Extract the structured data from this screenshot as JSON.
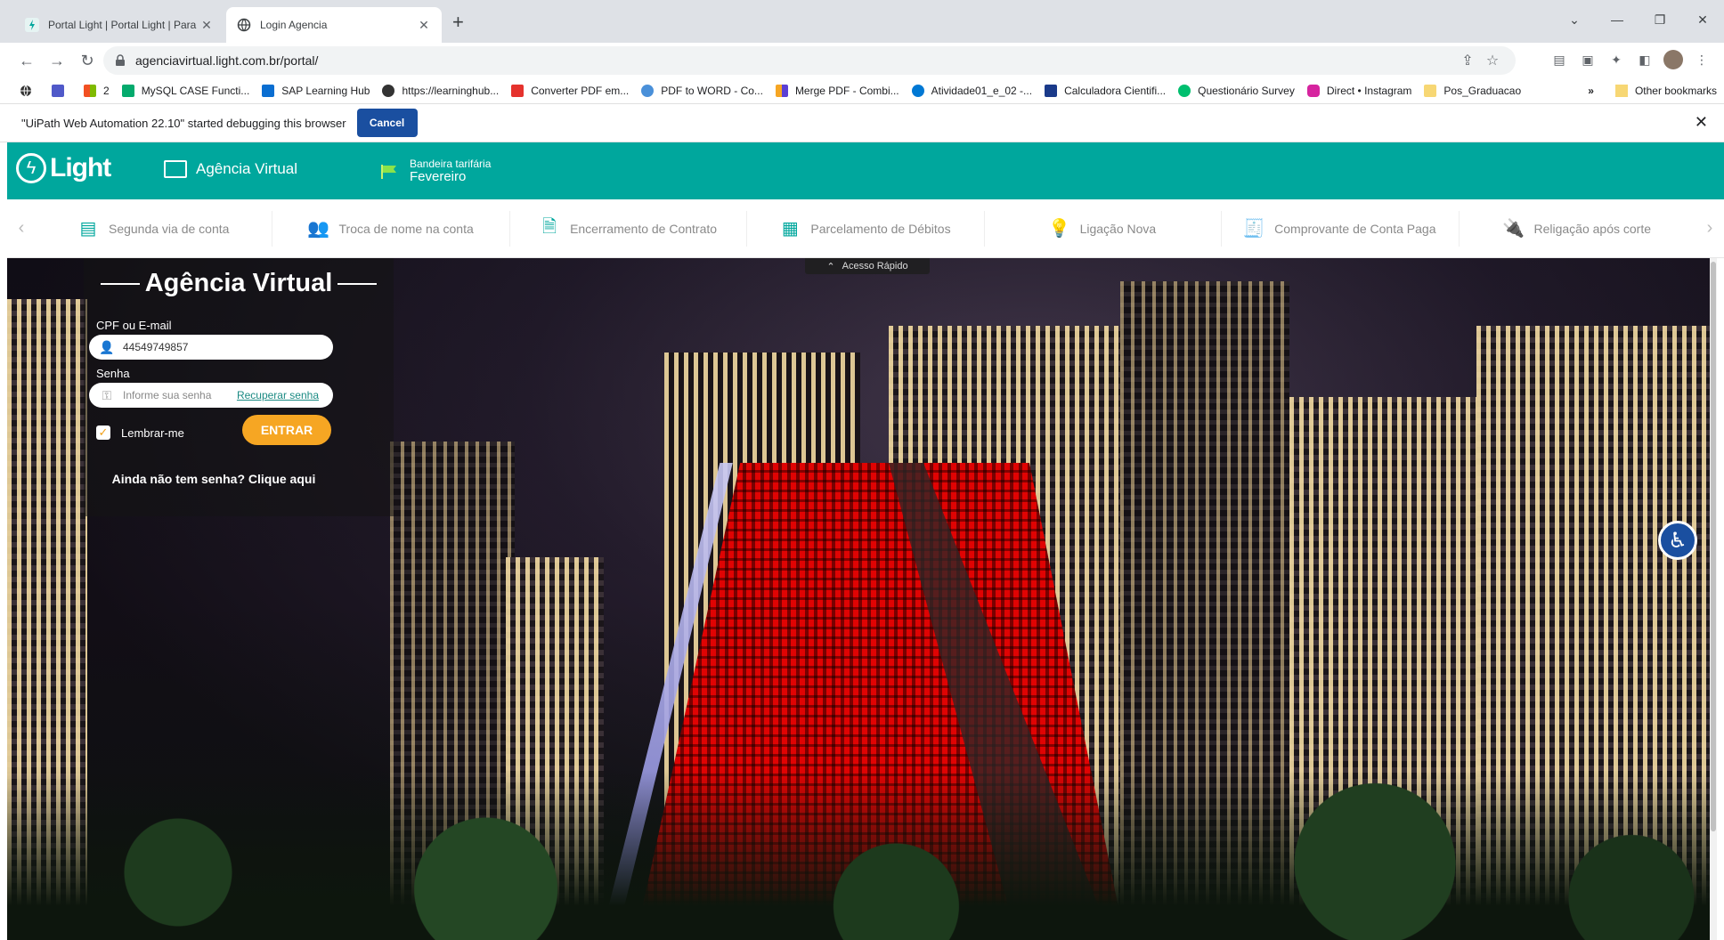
{
  "browser": {
    "tabs": [
      {
        "title": "Portal Light | Portal Light | Para E",
        "active": false
      },
      {
        "title": "Login Agencia",
        "active": true
      }
    ],
    "url": "agenciavirtual.light.com.br/portal/",
    "bookmarks": [
      {
        "label": "",
        "icon": "teams-icon",
        "color": "#5059c9"
      },
      {
        "label": "2",
        "icon": "windows-icon",
        "color": "#f25022"
      },
      {
        "label": "MySQL CASE Functi...",
        "icon": "w3-icon",
        "color": "#04aa6d"
      },
      {
        "label": "SAP Learning Hub",
        "icon": "sap-icon",
        "color": "#0a6ed1"
      },
      {
        "label": "https://learninghub...",
        "icon": "globe-icon",
        "color": "#333333"
      },
      {
        "label": "Converter PDF em...",
        "icon": "pdf-icon",
        "color": "#e5322d"
      },
      {
        "label": "PDF to WORD - Co...",
        "icon": "loop-icon",
        "color": "#4a90d9"
      },
      {
        "label": "Merge PDF - Combi...",
        "icon": "merge-icon",
        "color": "#f6a623"
      },
      {
        "label": "Atividade01_e_02 -...",
        "icon": "cloud-icon",
        "color": "#0078d4"
      },
      {
        "label": "Calculadora Cientifi...",
        "icon": "calc-icon",
        "color": "#1a3a8a"
      },
      {
        "label": "Questionário Survey",
        "icon": "survey-icon",
        "color": "#00bf6f"
      },
      {
        "label": "Direct • Instagram",
        "icon": "instagram-icon",
        "color": "#d6249f"
      },
      {
        "label": "Pos_Graduacao",
        "icon": "folder-icon",
        "color": "#f7d774"
      }
    ],
    "bookmarks_overflow": "»",
    "other_bookmarks": "Other bookmarks",
    "infobar_text": "\"UiPath Web Automation 22.10\" started debugging this browser",
    "infobar_cancel": "Cancel"
  },
  "header": {
    "logo_text": "Light",
    "agencia": "Agência Virtual",
    "bandeira_label": "Bandeira tarifária",
    "bandeira_value": "Fevereiro"
  },
  "quicknav": [
    {
      "label": "Segunda via de conta",
      "icon": "bill-icon"
    },
    {
      "label": "Troca de nome na conta",
      "icon": "users-icon"
    },
    {
      "label": "Encerramento de Contrato",
      "icon": "contract-close-icon"
    },
    {
      "label": "Parcelamento de Débitos",
      "icon": "calculator-icon"
    },
    {
      "label": "Ligação Nova",
      "icon": "lightbulb-icon"
    },
    {
      "label": "Comprovante de Conta Paga",
      "icon": "receipt-icon"
    },
    {
      "label": "Religação após corte",
      "icon": "plug-icon"
    }
  ],
  "acesso_rapido": "Acesso Rápido",
  "login": {
    "title": "Agência Virtual",
    "cpf_label": "CPF ou E-mail",
    "cpf_value": "44549749857",
    "senha_label": "Senha",
    "senha_placeholder": "Informe sua senha",
    "recuperar": "Recuperar senha",
    "lembrar": "Lembrar-me",
    "entrar": "ENTRAR",
    "nao_tem_senha": "Ainda não tem senha? Clique aqui"
  }
}
